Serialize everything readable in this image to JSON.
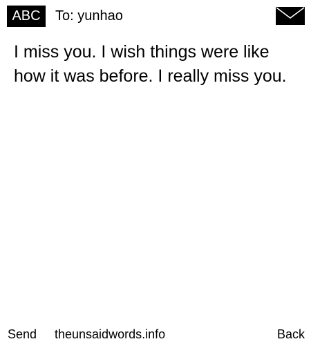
{
  "header": {
    "mode_label": "ABC",
    "recipient_label": "To: yunhao",
    "envelope_icon": "envelope-icon"
  },
  "message": {
    "text": "I miss you. I wish things were like how it was before. I really miss you."
  },
  "footer": {
    "send_label": "Send",
    "site_label": "theunsaidwords.info",
    "back_label": "Back"
  }
}
